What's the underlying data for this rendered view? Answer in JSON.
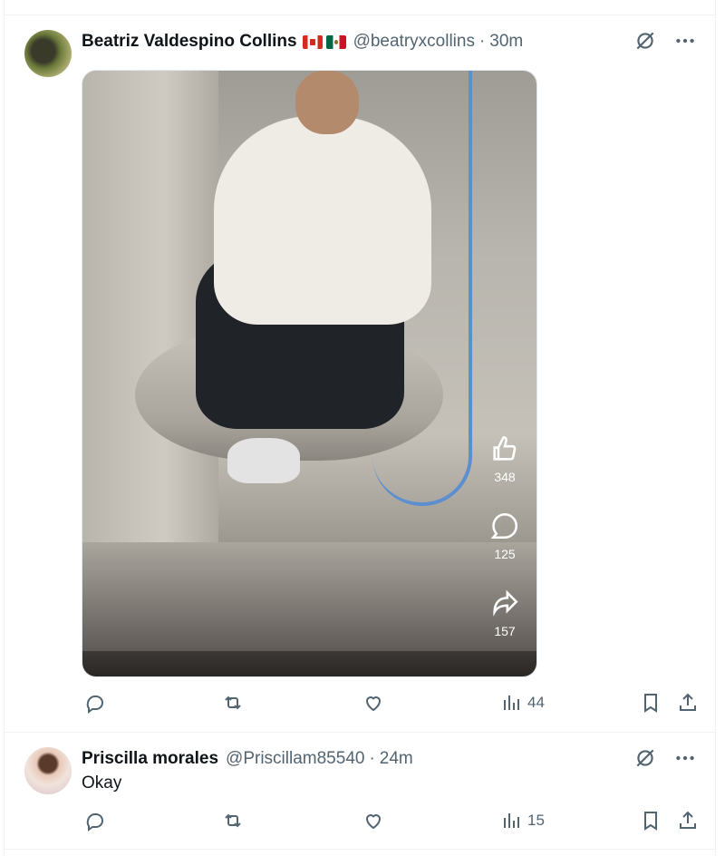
{
  "tweets": [
    {
      "author_name": "Beatriz Valdespino Collins",
      "flags": [
        "canada-flag",
        "mexico-flag"
      ],
      "handle": "@beatryxcollins",
      "separator": "·",
      "time": "30m",
      "media": {
        "type": "video",
        "overlay": {
          "likes": "348",
          "comments": "125",
          "shares": "157"
        }
      },
      "actions": {
        "views": "44"
      }
    },
    {
      "author_name": "Priscilla morales",
      "handle": "@Priscillam85540",
      "separator": "·",
      "time": "24m",
      "text": "Okay",
      "actions": {
        "views": "15"
      }
    }
  ],
  "icons": {
    "grok": "grok-icon",
    "more": "more-icon",
    "reply": "reply-icon",
    "retweet": "retweet-icon",
    "like": "heart-icon",
    "views": "views-chart-icon",
    "bookmark": "bookmark-icon",
    "share": "share-icon"
  },
  "colors": {
    "text": "#0f1419",
    "secondary": "#536471",
    "divider": "#eff3f4"
  }
}
